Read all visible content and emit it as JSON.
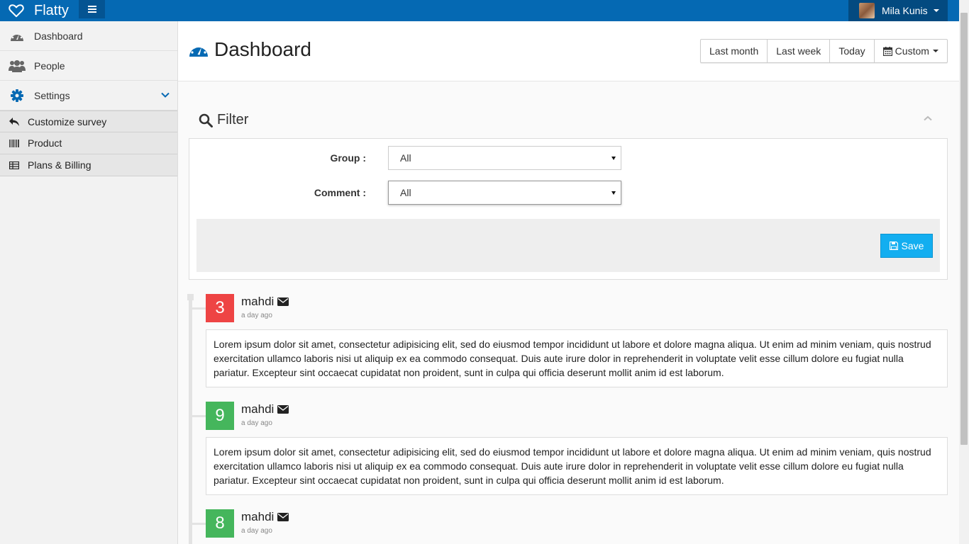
{
  "brand": {
    "name": "Flatty",
    "icon": "heart-icon"
  },
  "user": {
    "name": "Mila Kunis"
  },
  "sidebar": {
    "items": [
      {
        "label": "Dashboard",
        "icon": "dashboard-icon"
      },
      {
        "label": "People",
        "icon": "users-icon"
      },
      {
        "label": "Settings",
        "icon": "gear-icon"
      }
    ],
    "subitems": [
      {
        "label": "Customize survey",
        "icon": "reply-icon"
      },
      {
        "label": "Product",
        "icon": "barcode-icon"
      },
      {
        "label": "Plans & Billing",
        "icon": "table-icon"
      }
    ]
  },
  "header": {
    "title": "Dashboard",
    "ranges": [
      "Last month",
      "Last week",
      "Today",
      "Custom"
    ]
  },
  "filter": {
    "title": "Filter",
    "group_label": "Group :",
    "group_value": "All",
    "comment_label": "Comment :",
    "comment_value": "All",
    "save_label": "Save"
  },
  "timeline": [
    {
      "score": "3",
      "color": "#ee4444",
      "author": "mahdi",
      "time": "a day ago",
      "text": "Lorem ipsum dolor sit amet, consectetur adipisicing elit, sed do eiusmod tempor incididunt ut labore et dolore magna aliqua. Ut enim ad minim veniam, quis nostrud exercitation ullamco laboris nisi ut aliquip ex ea commodo consequat. Duis aute irure dolor in reprehenderit in voluptate velit esse cillum dolore eu fugiat nulla pariatur. Excepteur sint occaecat cupidatat non proident, sunt in culpa qui officia deserunt mollit anim id est laborum."
    },
    {
      "score": "9",
      "color": "#45b65c",
      "author": "mahdi",
      "time": "a day ago",
      "text": "Lorem ipsum dolor sit amet, consectetur adipisicing elit, sed do eiusmod tempor incididunt ut labore et dolore magna aliqua. Ut enim ad minim veniam, quis nostrud exercitation ullamco laboris nisi ut aliquip ex ea commodo consequat. Duis aute irure dolor in reprehenderit in voluptate velit esse cillum dolore eu fugiat nulla pariatur. Excepteur sint occaecat cupidatat non proident, sunt in culpa qui officia deserunt mollit anim id est laborum."
    },
    {
      "score": "8",
      "color": "#45b65c",
      "author": "mahdi",
      "time": "a day ago"
    }
  ],
  "colors": {
    "topbar": "#0569b3",
    "accent": "#13aef0",
    "icon_blue": "#0569b3"
  }
}
